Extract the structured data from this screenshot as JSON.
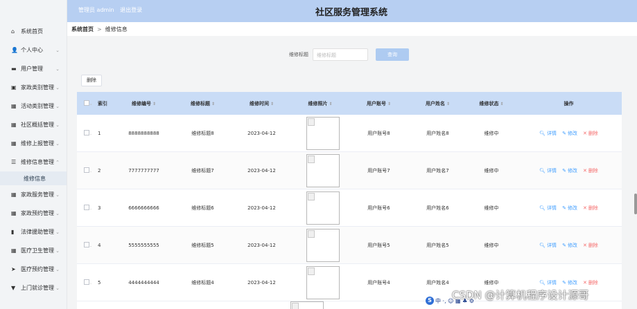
{
  "header": {
    "role_label": "管理员 admin",
    "logout_label": "退出登录",
    "title": "社区服务管理系统"
  },
  "sidebar": {
    "items": [
      {
        "label": "系统首页",
        "icon": "home-icon",
        "glyph": "⌂",
        "chev": ""
      },
      {
        "label": "个人中心",
        "icon": "user-icon",
        "glyph": "👤",
        "chev": "⌄"
      },
      {
        "label": "用户管理",
        "icon": "users-icon",
        "glyph": "▬",
        "chev": "⌄"
      },
      {
        "label": "家政类别管理",
        "icon": "category-icon",
        "glyph": "▣",
        "chev": "⌄"
      },
      {
        "label": "活动类别管理",
        "icon": "grid-icon",
        "glyph": "▦",
        "chev": "⌄"
      },
      {
        "label": "社区概括管理",
        "icon": "grid-icon",
        "glyph": "▦",
        "chev": "⌄"
      },
      {
        "label": "维修上报管理",
        "icon": "table-icon",
        "glyph": "▦",
        "chev": "⌄"
      },
      {
        "label": "维修信息管理",
        "icon": "sliders-icon",
        "glyph": "☰",
        "chev": "⌃"
      },
      {
        "label": "家政服务管理",
        "icon": "grid-icon",
        "glyph": "▦",
        "chev": "⌄"
      },
      {
        "label": "家政预约管理",
        "icon": "grid-icon",
        "glyph": "▦",
        "chev": "⌄"
      },
      {
        "label": "法律援助管理",
        "icon": "chart-icon",
        "glyph": "▮",
        "chev": "⌄"
      },
      {
        "label": "医疗卫生管理",
        "icon": "grid-icon",
        "glyph": "▦",
        "chev": "⌄"
      },
      {
        "label": "医疗预约管理",
        "icon": "send-icon",
        "glyph": "➤",
        "chev": "⌄"
      },
      {
        "label": "上门就诊管理",
        "icon": "pin-icon",
        "glyph": "▼",
        "chev": "⌄"
      }
    ],
    "active_sub": "维修信息"
  },
  "breadcrumb": {
    "home": "系统首页",
    "separator": ">",
    "current": "维修信息"
  },
  "search": {
    "label": "维修标题",
    "placeholder": "维修标题",
    "button": "查询"
  },
  "toolbar": {
    "delete_label": "删除"
  },
  "table": {
    "headers": {
      "index": "索引",
      "number": "维修编号",
      "title": "维修标题",
      "time": "维修时间",
      "photo": "维修照片",
      "account": "用户账号",
      "name": "用户姓名",
      "status": "维修状态",
      "ops": "操作"
    },
    "sort_glyph": "⇕",
    "rows": [
      {
        "index": "1",
        "number": "8888888888",
        "title": "维修标题8",
        "time": "2023-04-12",
        "account": "用户账号8",
        "name": "用户姓名8",
        "status": "维修中"
      },
      {
        "index": "2",
        "number": "7777777777",
        "title": "维修标题7",
        "time": "2023-04-12",
        "account": "用户账号7",
        "name": "用户姓名7",
        "status": "维修中"
      },
      {
        "index": "3",
        "number": "6666666666",
        "title": "维修标题6",
        "time": "2023-04-12",
        "account": "用户账号6",
        "name": "用户姓名6",
        "status": "维修中"
      },
      {
        "index": "4",
        "number": "5555555555",
        "title": "维修标题5",
        "time": "2023-04-12",
        "account": "用户账号5",
        "name": "用户姓名5",
        "status": "维修中"
      },
      {
        "index": "5",
        "number": "4444444444",
        "title": "维修标题4",
        "time": "2023-04-12",
        "account": "用户账号4",
        "name": "用户姓名4",
        "status": "维修中"
      }
    ],
    "ops": {
      "detail": "详情",
      "edit": "修改",
      "delete": "删除"
    }
  },
  "watermark": {
    "text": "CSDN @计算机程序设计源哥"
  },
  "ime": {
    "badge": "S",
    "glyphs": "中 ·, ☺ ▦ ♣ ⚙"
  },
  "colors": {
    "header_bg": "#b7cff2",
    "table_head_bg": "#c9dcf6",
    "query_button": "#aecbf1",
    "link_blue": "#409eff",
    "delete_red": "#f56c6c"
  }
}
